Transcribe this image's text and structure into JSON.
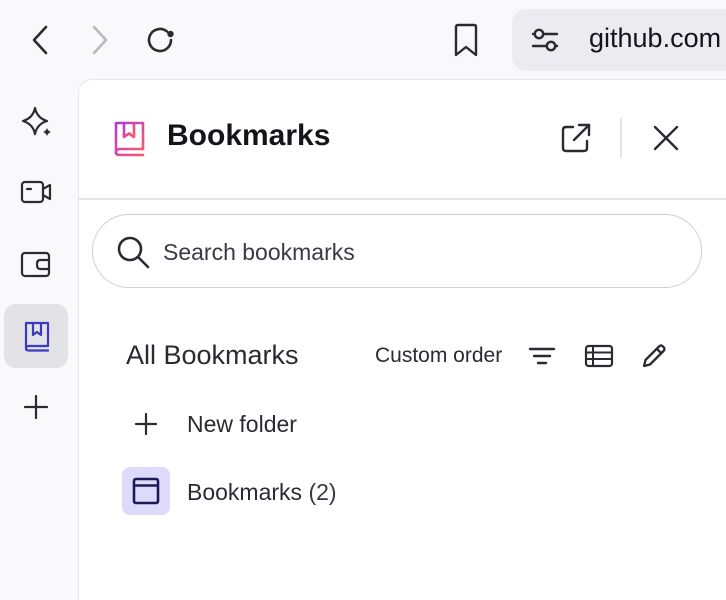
{
  "toolbar": {
    "back_icon": "chevron-left-icon",
    "forward_icon": "chevron-right-icon",
    "reload_icon": "reload-icon",
    "bookmark_icon": "bookmark-icon",
    "site_settings_icon": "sliders-icon",
    "url": "github.com"
  },
  "sidebar": {
    "items": [
      {
        "icon": "sparkle-icon"
      },
      {
        "icon": "video-camera-icon"
      },
      {
        "icon": "wallet-icon"
      },
      {
        "icon": "bookmarks-book-icon",
        "active": true
      },
      {
        "icon": "plus-icon"
      }
    ]
  },
  "panel": {
    "title": "Bookmarks",
    "search_placeholder": "Search bookmarks",
    "section_title": "All Bookmarks",
    "sort_label": "Custom order",
    "new_folder_label": "New folder",
    "folder": {
      "name": "Bookmarks",
      "count": "(2)"
    }
  },
  "colors": {
    "accent_active_bg": "#e2e2e7",
    "folder_tile_bg": "#dedbfa",
    "folder_icon": "#1c1b5a",
    "logo_gradient_start": "#b23bd6",
    "logo_gradient_end": "#ff5a6a"
  }
}
